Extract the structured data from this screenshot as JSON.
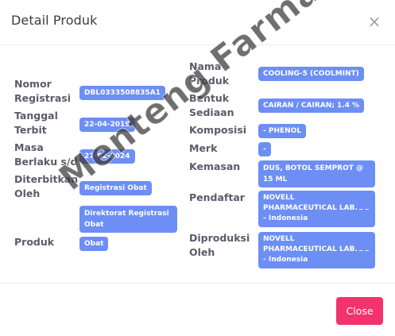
{
  "dialog": {
    "title": "Detail Produk",
    "close_icon": "×",
    "close_button_label": "Close"
  },
  "left_fields": [
    {
      "label": "Nomor Registrasi",
      "value": "DBL0333508835A1"
    },
    {
      "label": "Tanggal Terbit",
      "value": "22-04-2019"
    },
    {
      "label": "Masa Berlaku s/d",
      "value": "27-02-2024"
    },
    {
      "label": "Diterbitkan Oleh",
      "value": "Registrasi Obat"
    },
    {
      "label": "",
      "value": "Direktorat Registrasi Obat"
    },
    {
      "label": "Produk",
      "value": "Obat"
    }
  ],
  "right_fields": [
    {
      "label": "Nama Produk",
      "value": "COOLING-5 (COOLMINT)"
    },
    {
      "label": "Bentuk Sediaan",
      "value": "CAIRAN / CAIRAN; 1.4 %"
    },
    {
      "label": "Komposisi",
      "value": "- PHENOL"
    },
    {
      "label": "Merk",
      "value": "-"
    },
    {
      "label": "Kemasan",
      "value": "DUS, BOTOL SEMPROT @ 15 ML"
    },
    {
      "label": "Pendaftar",
      "value": "NOVELL PHARMACEUTICAL LAB. - Indonesia",
      "extra": "_ _"
    },
    {
      "label": "Diproduksi Oleh",
      "value": "NOVELL PHARMACEUTICAL LAB. - Indonesia",
      "extra": "_ _"
    }
  ],
  "watermark": {
    "text": "Menteng Farma"
  },
  "colors": {
    "pill": "#6c8ef5",
    "close_button": "#f2336d",
    "label": "#5a5c69"
  }
}
